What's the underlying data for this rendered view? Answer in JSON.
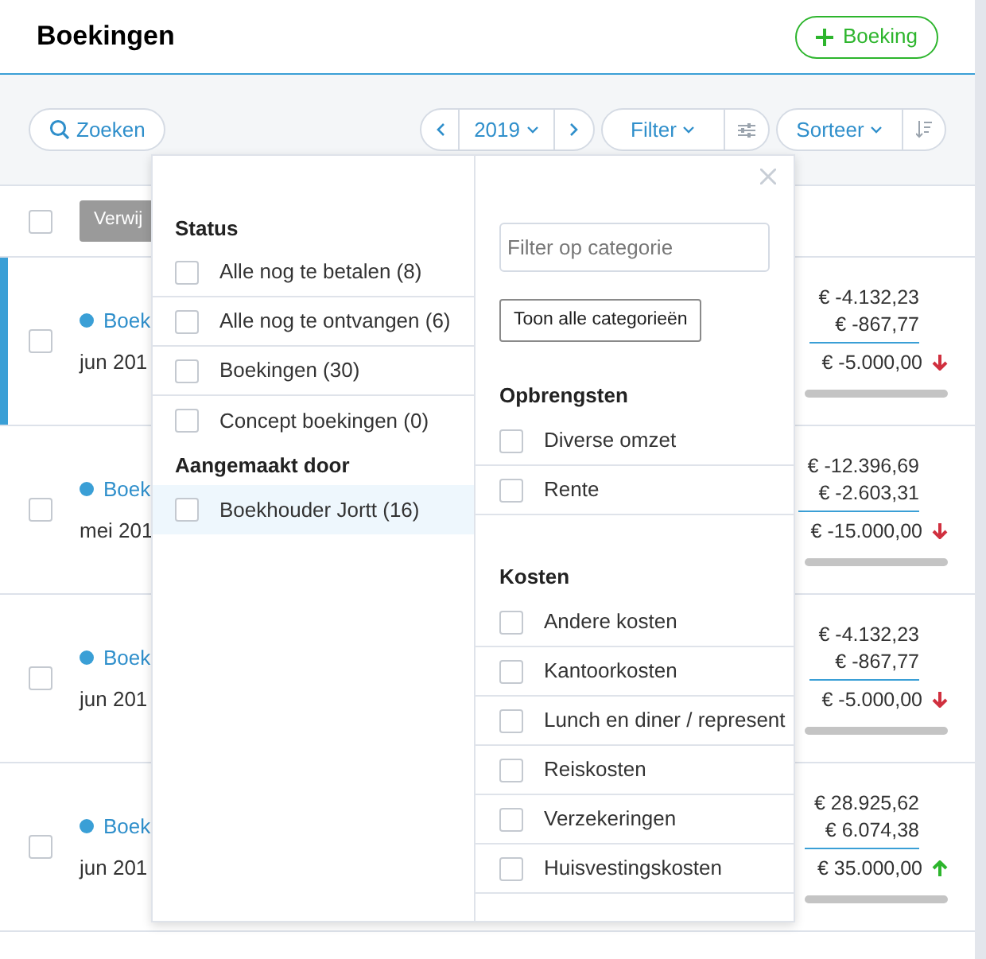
{
  "header": {
    "title": "Boekingen",
    "add_button": "Boeking"
  },
  "toolbar": {
    "search_button": "Zoeken",
    "year": "2019",
    "filter_button": "Filter",
    "sort_button": "Sorteer"
  },
  "list": {
    "select_all_checked": false,
    "delete_button": "Verwij",
    "rows": [
      {
        "selected": true,
        "checked": false,
        "title": "Boek",
        "date": "jun 201",
        "amount_1": "€ -4.132,23",
        "amount_2": "€ -867,77",
        "total": "€ -5.000,00",
        "kind": "decrease",
        "level": 1
      },
      {
        "selected": false,
        "checked": false,
        "title": "Boek",
        "date": "mei 201",
        "amount_1": "€ -12.396,69",
        "amount_2": "€ -2.603,31",
        "total": "€ -15.000,00",
        "kind": "decrease",
        "level": 1
      },
      {
        "selected": false,
        "checked": false,
        "title": "Boek",
        "date": "jun 201",
        "amount_1": "€ -4.132,23",
        "amount_2": "€ -867,77",
        "total": "€ -5.000,00",
        "kind": "decrease",
        "level": 1
      },
      {
        "selected": false,
        "checked": false,
        "title": "Boek",
        "date": "jun 201",
        "amount_1": "€ 28.925,62",
        "amount_2": "€ 6.074,38",
        "total": "€ 35.000,00",
        "kind": "increase",
        "level": 1
      }
    ]
  },
  "filter_popup": {
    "groups": [
      {
        "heading": "Status",
        "items": [
          {
            "label": "Alle nog te betalen (8)",
            "checked": false,
            "highlighted": false
          },
          {
            "label": "Alle nog te ontvangen (6)",
            "checked": false,
            "highlighted": false
          },
          {
            "label": "Boekingen (30)",
            "checked": false,
            "highlighted": false
          },
          {
            "label": "Concept boekingen (0)",
            "checked": false,
            "highlighted": false
          }
        ]
      },
      {
        "heading": "Aangemaakt door",
        "items": [
          {
            "label": "Boekhouder Jortt (16)",
            "checked": false,
            "highlighted": true
          }
        ]
      }
    ],
    "category_search": {
      "placeholder": "Filter op categorie"
    },
    "show_all_button": "Toon alle categorieën",
    "categories": [
      {
        "heading": "Opbrengsten",
        "items": [
          {
            "label": "Diverse omzet",
            "checked": false
          },
          {
            "label": "Rente",
            "checked": false
          }
        ]
      },
      {
        "heading": "Kosten",
        "items": [
          {
            "label": "Andere kosten",
            "checked": false
          },
          {
            "label": "Kantoorkosten",
            "checked": false
          },
          {
            "label": "Lunch en diner / represent",
            "checked": false
          },
          {
            "label": "Reiskosten",
            "checked": false
          },
          {
            "label": "Verzekeringen",
            "checked": false
          },
          {
            "label": "Huisvestingskosten",
            "checked": false
          }
        ]
      }
    ]
  }
}
